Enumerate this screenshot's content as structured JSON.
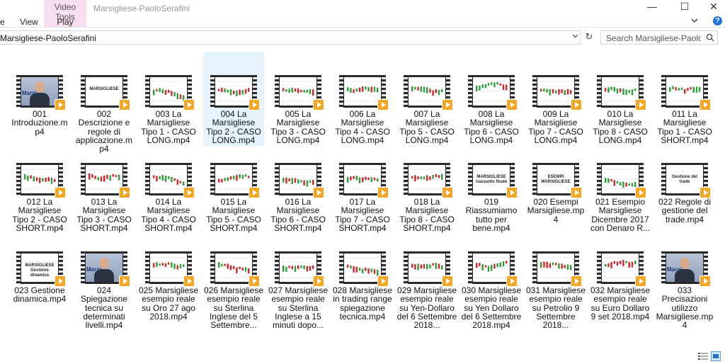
{
  "window": {
    "title": "Marsigliese-PaoloSerafini",
    "ribbon_left_tab": "e",
    "ribbon_view_tab": "View",
    "context_group": "Video Tools",
    "context_tab": "Play",
    "minimize": "—",
    "maximize": "☐",
    "close": "✕"
  },
  "address": {
    "path": "Marsigliese-PaoloSerafini",
    "refresh": "↻"
  },
  "search": {
    "placeholder": "Search Marsigliese-PaoloSeraf..."
  },
  "files": [
    {
      "label": "001 Introduzione.mp4",
      "thumb": "person"
    },
    {
      "label": "002  Descrizione e regole di applicazione.mp4",
      "thumb": "title",
      "thumb_text": "MARSIGLIESE"
    },
    {
      "label": "003 La Marsigliese Tipo 1 - CASO LONG.mp4",
      "thumb": "chart"
    },
    {
      "label": "004 La Marsigliese Tipo 2 - CASO LONG.mp4",
      "thumb": "chart",
      "selected": true
    },
    {
      "label": "005  La Marsigliese Tipo 3 - CASO LONG.mp4",
      "thumb": "chart"
    },
    {
      "label": "006 La Marsigliese Tipo 4 - CASO LONG.mp4",
      "thumb": "chart"
    },
    {
      "label": "007 La Marsigliese Tipo 5 - CASO LONG.mp4",
      "thumb": "chart"
    },
    {
      "label": "008 La Marsigliese Tipo 6 - CASO LONG.mp4",
      "thumb": "chart"
    },
    {
      "label": "009 La Marsigliese Tipo 7 - CASO LONG.mp4",
      "thumb": "chart"
    },
    {
      "label": "010 La Marsigliese Tipo 8 - CASO LONG.mp4",
      "thumb": "chart"
    },
    {
      "label": "011 La Marsigliese Tipo 1 - CASO SHORT.mp4",
      "thumb": "chart"
    },
    {
      "label": "012 La Marsigliese Tipo 2 - CASO SHORT.mp4",
      "thumb": "chart"
    },
    {
      "label": "013 La Marsigliese Tipo 3 - CASO SHORT.mp4",
      "thumb": "chart"
    },
    {
      "label": "014 La Marsigliese Tipo 4 - CASO SHORT.mp4",
      "thumb": "chart"
    },
    {
      "label": "015 La Marsigliese Tipo 5 - CASO SHORT.mp4",
      "thumb": "chart"
    },
    {
      "label": "016 La Marsigliese Tipo 6 - CASO SHORT.mp4",
      "thumb": "chart"
    },
    {
      "label": "017 La Marsigliese Tipo 7 - CASO SHORT.mp4",
      "thumb": "chart"
    },
    {
      "label": "018 La Marsigliese Tipo 8 - CASO SHORT.mp4",
      "thumb": "chart"
    },
    {
      "label": "019 Riassumiamo tutto per bene.mp4",
      "thumb": "title",
      "thumb_text": "MARSIGLIESE riassunto finale"
    },
    {
      "label": "020 Esempi Marsigliese.mp4",
      "thumb": "title",
      "thumb_text": "ESEMPI MARSIGLIESE"
    },
    {
      "label": "021 Esempio Marsigliese Dicembre 2017 con Denaro R...",
      "thumb": "chart"
    },
    {
      "label": "022 Regole di gestione del trade.mp4",
      "thumb": "title",
      "thumb_text": "Gestione del trade"
    },
    {
      "label": "023 Gestione dinamica.mp4",
      "thumb": "title",
      "thumb_text": "MARSIGLIESE Gestione dinamica"
    },
    {
      "label": "024  Spiegazione tecnica su determinati livelli.mp4",
      "thumb": "person"
    },
    {
      "label": "025  Marsigliese esempio reale su Oro 27 ago 2018.mp4",
      "thumb": "chart"
    },
    {
      "label": "026 Marsigliese esempio reale su Sterlina Inglese del 5 Settembre...",
      "thumb": "chart"
    },
    {
      "label": "027 Marsigliese esempio reale su Sterlina Inglese a 15 minuti dopo...",
      "thumb": "chart"
    },
    {
      "label": "028 Marsigliese in trading range spiegazione tecnica.mp4",
      "thumb": "chart"
    },
    {
      "label": "029 Marsigliese esempio reale su Yen-Dollaro del 6 Settembre 2018...",
      "thumb": "chart"
    },
    {
      "label": "030 Marsigliese esempio reale su Yen  Dollaro del 6 Settembre 2018.mp4",
      "thumb": "chart"
    },
    {
      "label": "031 Marsigliese esempio reale su Petrolio 9 Settembre 2018...",
      "thumb": "chart"
    },
    {
      "label": "032 Marsigliese esempio reale su Euro Dollaro 9 set 2018.mp4",
      "thumb": "chart"
    },
    {
      "label": "033 Precisazioni utilizzo Marsigliese.mp4",
      "thumb": "person"
    }
  ],
  "brand_text": "Marsi",
  "colors": {
    "selection": "#e5f3ff",
    "play_badge": "#f5a623",
    "accent": "#1e73d6"
  }
}
